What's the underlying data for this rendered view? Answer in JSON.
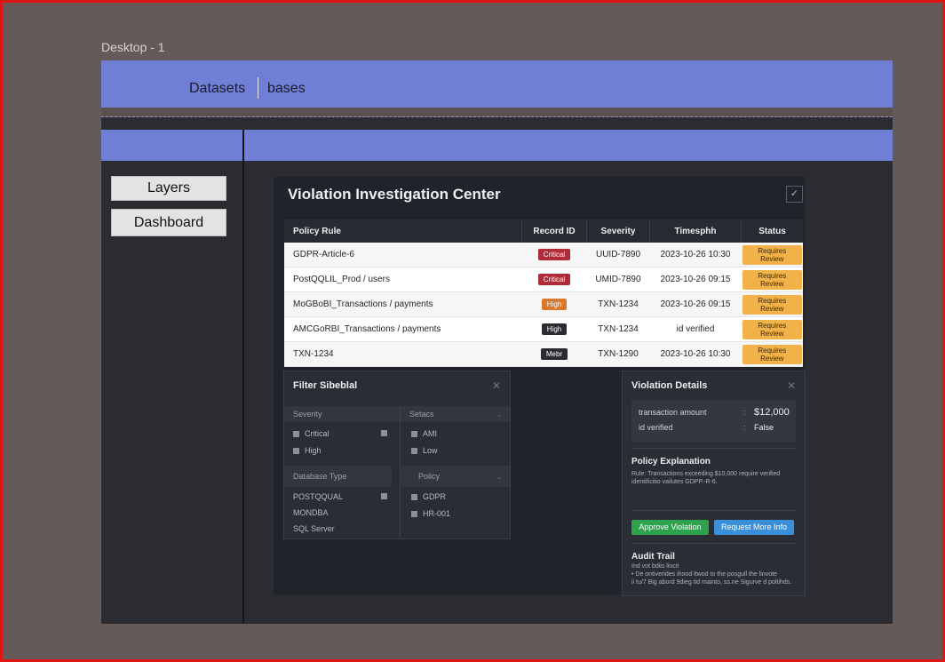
{
  "frame": {
    "label": "Desktop - 1"
  },
  "topbar": {
    "crumb1": "Datasets",
    "crumb2": "bases"
  },
  "sidebar": {
    "buttons": [
      "Layers",
      "Dashboard"
    ]
  },
  "app": {
    "title": "Violation Investigation Center",
    "table": {
      "headers": [
        "Policy Rule",
        "Record ID",
        "Severity",
        "Timesphh",
        "Status"
      ],
      "rows": [
        {
          "rule": "GDPR-Article-6",
          "severity": "Critical",
          "sevStyle": "critical",
          "record": "UUID-7890",
          "time": "2023-10-26 10:30",
          "status": "Requires Review"
        },
        {
          "rule": "PostQQLIL_Prod / users",
          "severity": "Critical",
          "sevStyle": "critical",
          "record": "UMID-7890",
          "time": "2023-10-26 09:15",
          "status": "Requires Review"
        },
        {
          "rule": "MoGBoBI_Transactions / payments",
          "severity": "High",
          "sevStyle": "high",
          "record": "TXN-1234",
          "time": "2023-10-26 09:15",
          "status": "Requires Review"
        },
        {
          "rule": "AMCGoRBI_Transactions / payments",
          "severity": "High",
          "sevStyle": "dark",
          "record": "TXN-1234",
          "time": "id verified",
          "status": "Requires Review"
        },
        {
          "rule": "TXN-1234",
          "severity": "Mebr",
          "sevStyle": "dark",
          "record": "TXN-1290",
          "time": "2023-10-26 10:30",
          "status": "Requires Review"
        }
      ]
    },
    "filter": {
      "title": "Filter Sibeblal",
      "severity_label": "Severity",
      "setacs_label": "Setacs",
      "sev_opts": [
        "Critical",
        "High"
      ],
      "setacs_opts": [
        "AMI",
        "Low"
      ],
      "dbtype_label": "Database Type",
      "policy_label": "Policy",
      "db_opts": [
        "POSTQQUAL",
        "MONDBA",
        "SQL Server"
      ],
      "policy_opts": [
        "GDPR",
        "HR-001"
      ]
    },
    "details": {
      "title": "Violation Details",
      "kv": [
        {
          "key": "transaction amount",
          "value": "$12,000"
        },
        {
          "key": "id verified",
          "value": "False"
        }
      ],
      "policy_title": "Policy Explanation",
      "policy_text": "Rule: Transactions exceeding $10,000 require verified identificitio vailutes GDPP.-R-6.",
      "approve": "Approve Violation",
      "request": "Request More Info",
      "audit_title": "Audit Trail",
      "audit_lines": [
        "Ind vot bdiis lincit",
        "• De ontiverides ihood ltwod to the posgull the linvote",
        "ii tu/7 Big abord 9dieg tid mainto, ss.ne Sigurve d poltihds."
      ]
    }
  }
}
